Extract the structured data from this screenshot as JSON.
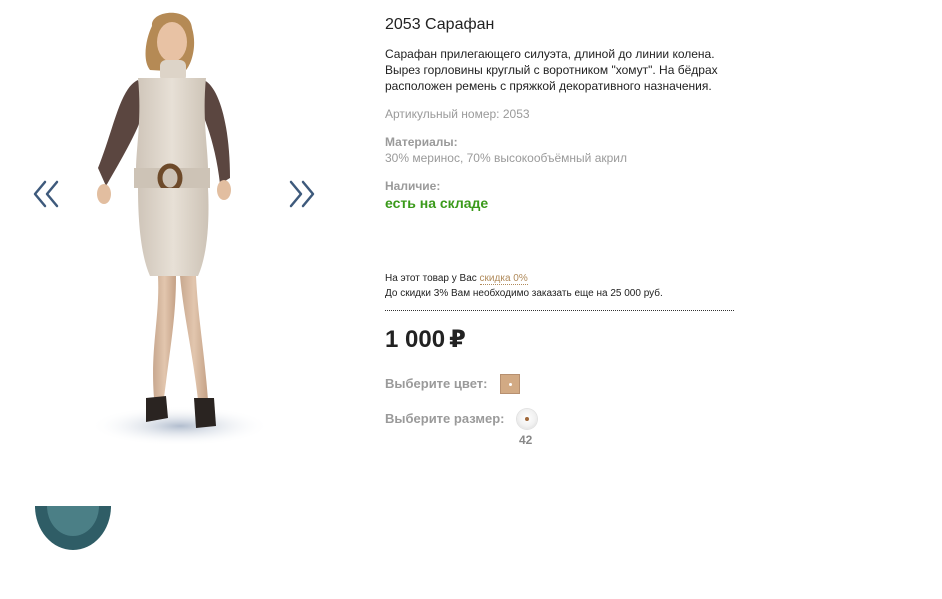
{
  "product": {
    "title": "2053 Сарафан",
    "description": "Сарафан прилегающего силуэта, длиной до линии колена. Вырез горловины круглый с воротником \"хомут\". На бёдрах расположен ремень с пряжкой декоративного назначения.",
    "article": "Артикульный номер: 2053",
    "materials_label": "Материалы:",
    "materials_value": "30% меринос, 70% высокообъёмный акрил",
    "availability_label": "Наличие:",
    "availability_value": "есть на складе"
  },
  "discount": {
    "line1_prefix": "На этот товар у Вас",
    "line1_link": "скидка 0%",
    "line2": "До скидки 3% Вам необходимо заказать еще на 25 000 руб."
  },
  "price": {
    "amount": "1 000",
    "currency": "₽"
  },
  "options": {
    "color_label": "Выберите цвет:",
    "size_label": "Выберите размер:",
    "sizes": [
      "42"
    ]
  },
  "colors": {
    "availability": "#3a9a1a",
    "link": "#b08a5a",
    "swatch": "#d2aa84",
    "label": "#9a9a9a"
  },
  "icons": {
    "prev": "double-chevron-left-icon",
    "next": "double-chevron-right-icon"
  }
}
